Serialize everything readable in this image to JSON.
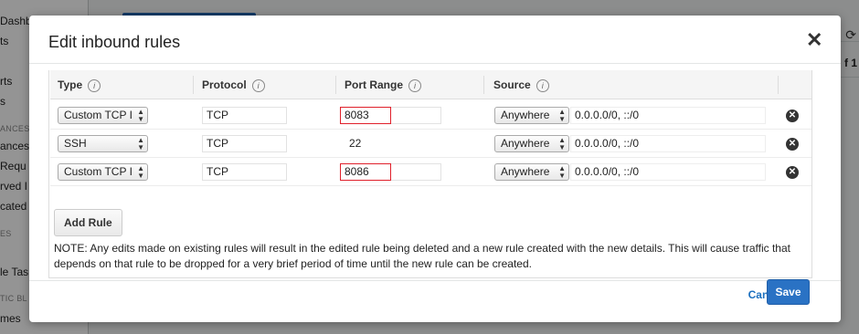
{
  "background": {
    "sidebar_items": [
      "Dashb",
      "ts",
      "rts",
      "s",
      "ANCES",
      "ances",
      "Requ",
      "rved I",
      "cated",
      "ES",
      "le Tas",
      "TIC BL",
      "mes"
    ],
    "right_text": "f 1"
  },
  "modal": {
    "title": "Edit inbound rules",
    "close_glyph": "✕"
  },
  "table": {
    "headers": {
      "type": "Type",
      "protocol": "Protocol",
      "port_range": "Port Range",
      "source": "Source"
    },
    "info_glyph": "i",
    "rows": [
      {
        "type": "Custom TCP I",
        "protocol": "TCP",
        "port": "8083",
        "source_type": "Anywhere",
        "source_value": "0.0.0.0/0, ::/0"
      },
      {
        "type": "SSH",
        "protocol": "TCP",
        "port": "22",
        "source_type": "Anywhere",
        "source_value": "0.0.0.0/0, ::/0"
      },
      {
        "type": "Custom TCP I",
        "protocol": "TCP",
        "port": "8086",
        "source_type": "Anywhere",
        "source_value": "0.0.0.0/0, ::/0"
      }
    ]
  },
  "add_rule_label": "Add Rule",
  "note": "NOTE: Any edits made on existing rules will result in the edited rule being deleted and a new rule created with the new details. This will cause traffic that depends on that rule to be dropped for a very brief period of time until the new rule can be created.",
  "footer": {
    "cancel_label": "Cancel",
    "save_label": "Save"
  },
  "colors": {
    "primary_button": "#2a72c4",
    "link": "#1a6fbf",
    "highlight": "#e0202b"
  }
}
